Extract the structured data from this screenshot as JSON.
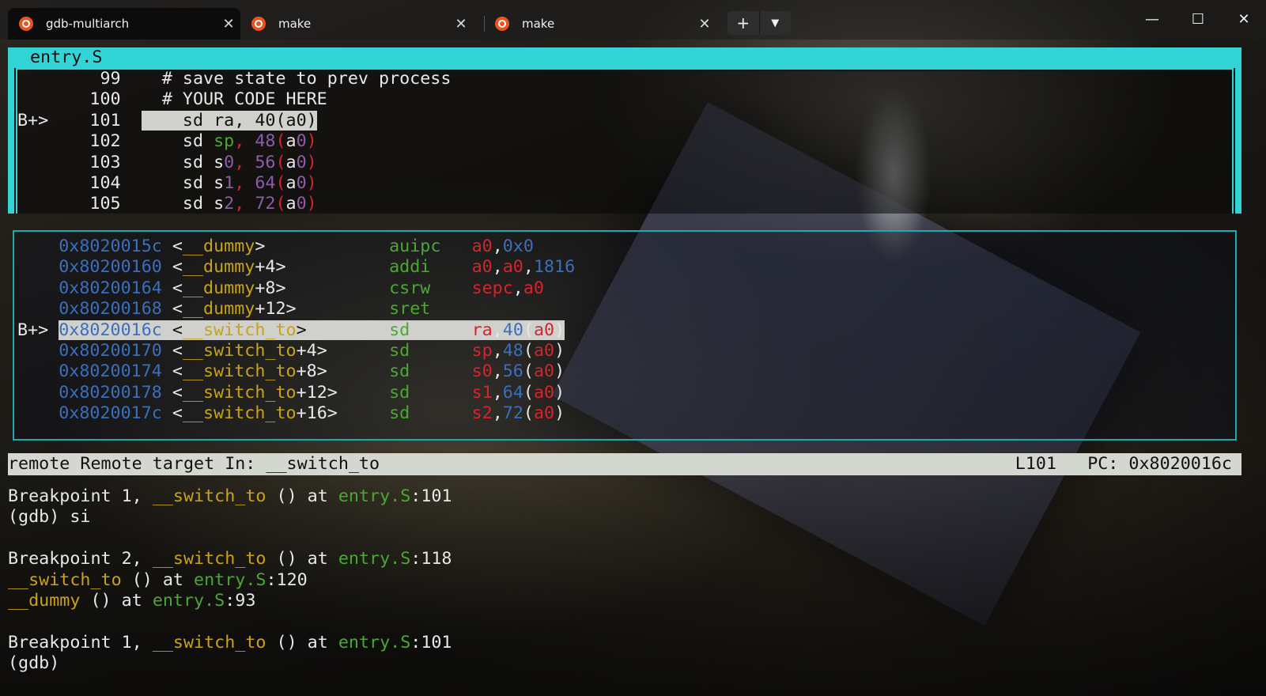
{
  "tabs": [
    {
      "label": "gdb-multiarch",
      "icon": "ubuntu-icon",
      "active": true
    },
    {
      "label": "make",
      "icon": "ubuntu-icon",
      "active": false
    },
    {
      "label": "make",
      "icon": "ubuntu-icon",
      "active": false
    }
  ],
  "window_controls": {
    "minimize": "—",
    "maximize": "☐",
    "close": "✕",
    "new_tab": "+",
    "dropdown": "⌄"
  },
  "source": {
    "title": "entry.S",
    "lines": [
      {
        "marker": "",
        "num": "99",
        "code": "# save state to prev process"
      },
      {
        "marker": "",
        "num": "100",
        "code": "# YOUR CODE HERE"
      },
      {
        "marker": "B+>",
        "num": "101",
        "op": "sd",
        "reg": "ra",
        "off": "40",
        "base": "a0"
      },
      {
        "marker": "",
        "num": "102",
        "op": "sd",
        "reg": "sp",
        "off": "48",
        "base": "a0"
      },
      {
        "marker": "",
        "num": "103",
        "op": "sd",
        "reg": "s0",
        "off": "56",
        "base": "a0"
      },
      {
        "marker": "",
        "num": "104",
        "op": "sd",
        "reg": "s1",
        "off": "64",
        "base": "a0"
      },
      {
        "marker": "",
        "num": "105",
        "op": "sd",
        "reg": "s2",
        "off": "72",
        "base": "a0"
      }
    ]
  },
  "asm": {
    "lines": [
      {
        "marker": "",
        "addr": "0x8020015c",
        "sym": "__dummy",
        "symoff": "",
        "op": "auipc",
        "args": [
          "a0",
          ",",
          "0x0"
        ]
      },
      {
        "marker": "",
        "addr": "0x80200160",
        "sym": "__dummy",
        "symoff": "+4",
        "op": "addi",
        "args": [
          "a0",
          ",",
          "a0",
          ",",
          "1816"
        ]
      },
      {
        "marker": "",
        "addr": "0x80200164",
        "sym": "__dummy",
        "symoff": "+8",
        "op": "csrw",
        "args": [
          "sepc",
          ",",
          "a0"
        ]
      },
      {
        "marker": "",
        "addr": "0x80200168",
        "sym": "__dummy",
        "symoff": "+12",
        "op": "sret",
        "args": []
      },
      {
        "marker": "B+>",
        "addr": "0x8020016c",
        "sym": "__switch_to",
        "symoff": "",
        "op": "sd",
        "args": [
          "ra",
          ",",
          "40",
          "(",
          "a0",
          ")"
        ]
      },
      {
        "marker": "",
        "addr": "0x80200170",
        "sym": "__switch_to",
        "symoff": "+4",
        "op": "sd",
        "args": [
          "sp",
          ",",
          "48",
          "(",
          "a0",
          ")"
        ]
      },
      {
        "marker": "",
        "addr": "0x80200174",
        "sym": "__switch_to",
        "symoff": "+8",
        "op": "sd",
        "args": [
          "s0",
          ",",
          "56",
          "(",
          "a0",
          ")"
        ]
      },
      {
        "marker": "",
        "addr": "0x80200178",
        "sym": "__switch_to",
        "symoff": "+12",
        "op": "sd",
        "args": [
          "s1",
          ",",
          "64",
          "(",
          "a0",
          ")"
        ]
      },
      {
        "marker": "",
        "addr": "0x8020017c",
        "sym": "__switch_to",
        "symoff": "+16",
        "op": "sd",
        "args": [
          "s2",
          ",",
          "72",
          "(",
          "a0",
          ")"
        ]
      }
    ]
  },
  "status": {
    "left": "remote Remote target In: __switch_to",
    "line": "L101",
    "pc": "PC: 0x8020016c"
  },
  "console": [
    {
      "parts": [
        [
          "w",
          "Breakpoint 1, "
        ],
        [
          "y",
          "__switch_to"
        ],
        [
          "w",
          " () at "
        ],
        [
          "g",
          "entry.S"
        ],
        [
          "w",
          ":101"
        ]
      ]
    },
    {
      "parts": [
        [
          "w",
          "(gdb) si"
        ]
      ]
    },
    {
      "parts": []
    },
    {
      "parts": [
        [
          "w",
          "Breakpoint 2, "
        ],
        [
          "y",
          "__switch_to"
        ],
        [
          "w",
          " () at "
        ],
        [
          "g",
          "entry.S"
        ],
        [
          "w",
          ":118"
        ]
      ]
    },
    {
      "parts": [
        [
          "y",
          "__switch_to"
        ],
        [
          "w",
          " () at "
        ],
        [
          "g",
          "entry.S"
        ],
        [
          "w",
          ":120"
        ]
      ]
    },
    {
      "parts": [
        [
          "y",
          "__dummy"
        ],
        [
          "w",
          " () at "
        ],
        [
          "g",
          "entry.S"
        ],
        [
          "w",
          ":93"
        ]
      ]
    },
    {
      "parts": []
    },
    {
      "parts": [
        [
          "w",
          "Breakpoint 1, "
        ],
        [
          "y",
          "__switch_to"
        ],
        [
          "w",
          " () at "
        ],
        [
          "g",
          "entry.S"
        ],
        [
          "w",
          ":101"
        ]
      ]
    },
    {
      "parts": [
        [
          "w",
          "(gdb)"
        ]
      ]
    }
  ],
  "colors": {
    "frame": "#32d4d6",
    "asm_frame": "#1fa8ae",
    "green": "#4aa832",
    "yellow": "#c9a216",
    "red": "#d8232c",
    "blue": "#3a6fbd",
    "purple": "#8e5ca8",
    "ubuntu": "#e95420"
  }
}
